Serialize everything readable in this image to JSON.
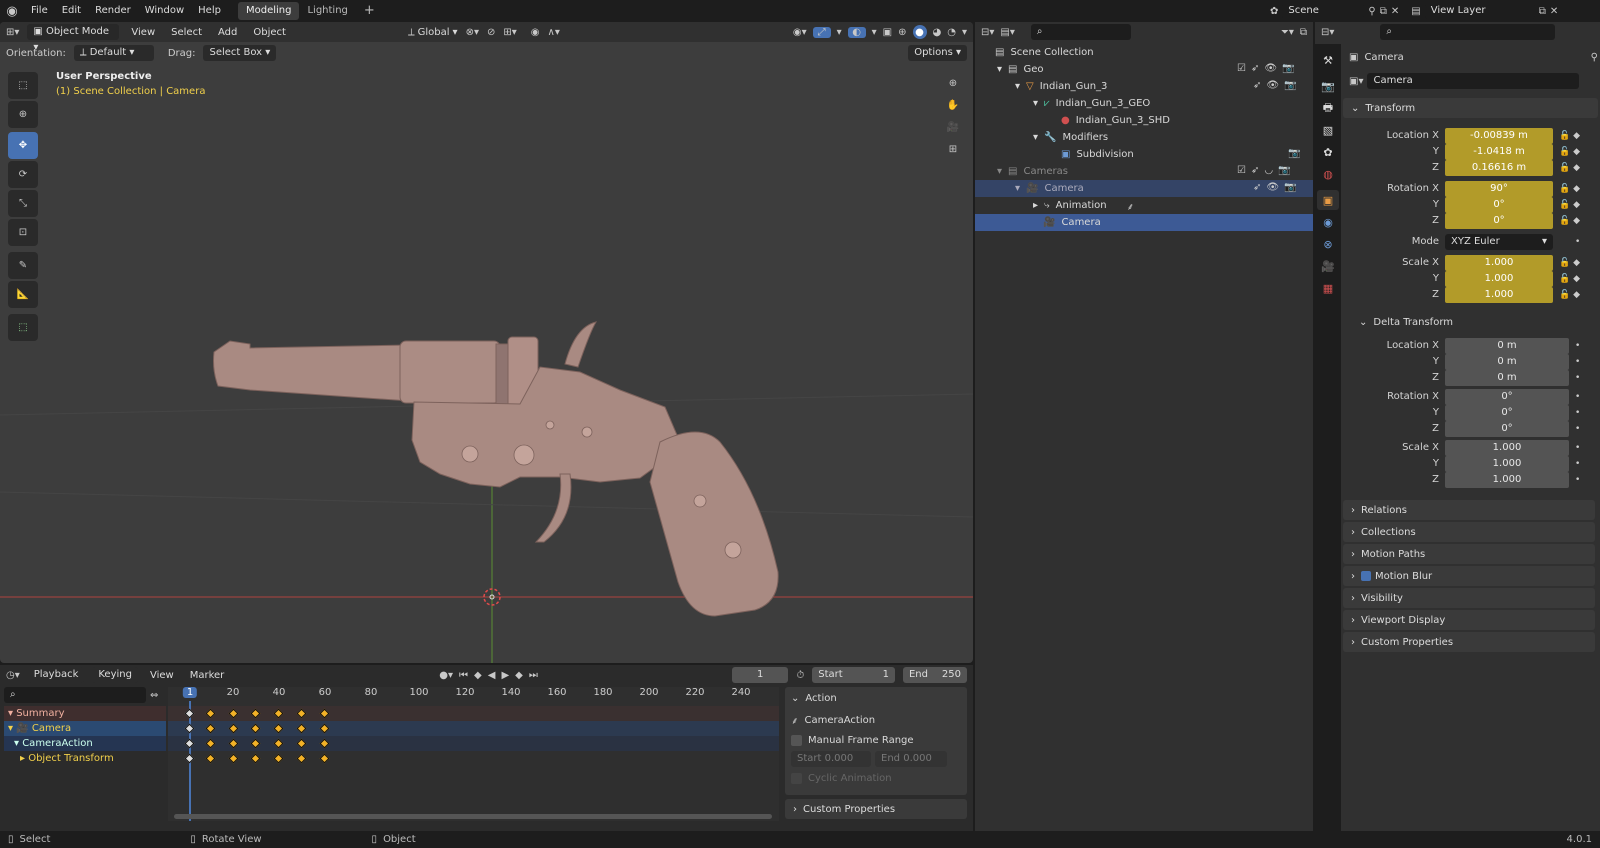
{
  "topbar": {
    "menus": [
      "File",
      "Edit",
      "Render",
      "Window",
      "Help"
    ],
    "workspaces": [
      "Modeling",
      "Lighting"
    ],
    "active_workspace": "Modeling",
    "add_tab": "+",
    "scene": "Scene",
    "view_layer": "View Layer"
  },
  "viewport": {
    "mode": "Object Mode",
    "menus": [
      "View",
      "Select",
      "Add",
      "Object"
    ],
    "transform_orientation": "Global",
    "orientation_label": "Orientation:",
    "orientation_value": "Default",
    "drag_label": "Drag:",
    "drag_value": "Select Box",
    "options": "Options",
    "overlay_title": "User Perspective",
    "overlay_sub": "(1) Scene Collection | Camera"
  },
  "timeline": {
    "menus": [
      "Playback",
      "Keying",
      "View",
      "Marker"
    ],
    "current_frame": "1",
    "start_label": "Start",
    "start": "1",
    "end_label": "End",
    "end": "250",
    "ruler": [
      "1",
      "20",
      "40",
      "60",
      "80",
      "100",
      "120",
      "140",
      "160",
      "180",
      "200",
      "220",
      "240"
    ],
    "channels": [
      "Summary",
      "Camera",
      "CameraAction",
      "Object Transform"
    ],
    "keyframes": [
      1,
      10,
      20,
      30,
      40,
      50,
      60
    ],
    "action_panel": {
      "title": "Action",
      "action_name": "CameraAction",
      "manual_frame_range": "Manual Frame Range",
      "start_label": "Start",
      "start": "0.000",
      "end_label": "End",
      "end": "0.000",
      "cyclic": "Cyclic Animation",
      "custom_props": "Custom Properties"
    }
  },
  "outliner": {
    "rows": [
      {
        "label": "Scene Collection"
      },
      {
        "label": "Geo"
      },
      {
        "label": "Indian_Gun_3"
      },
      {
        "label": "Indian_Gun_3_GEO"
      },
      {
        "label": "Indian_Gun_3_SHD"
      },
      {
        "label": "Modifiers"
      },
      {
        "label": "Subdivision"
      },
      {
        "label": "Cameras"
      },
      {
        "label": "Camera"
      },
      {
        "label": "Animation"
      },
      {
        "label": "Camera"
      }
    ]
  },
  "properties": {
    "object_name": "Camera",
    "object_field": "Camera",
    "transform_title": "Transform",
    "location": {
      "label": "Location X",
      "x": "-0.00839 m",
      "y": "-1.0418 m",
      "z": "0.16616 m"
    },
    "rotation": {
      "label": "Rotation X",
      "x": "90°",
      "y": "0°",
      "z": "0°"
    },
    "mode_label": "Mode",
    "mode_value": "XYZ Euler",
    "scale": {
      "label": "Scale X",
      "x": "1.000",
      "y": "1.000",
      "z": "1.000"
    },
    "axis_y": "Y",
    "axis_z": "Z",
    "delta_title": "Delta Transform",
    "delta_location": {
      "label": "Location X",
      "x": "0 m",
      "y": "0 m",
      "z": "0 m"
    },
    "delta_rotation": {
      "label": "Rotation X",
      "x": "0°",
      "y": "0°",
      "z": "0°"
    },
    "delta_scale": {
      "label": "Scale X",
      "x": "1.000",
      "y": "1.000",
      "z": "1.000"
    },
    "panels": [
      "Relations",
      "Collections",
      "Motion Paths",
      "Motion Blur",
      "Visibility",
      "Viewport Display",
      "Custom Properties"
    ]
  },
  "status": {
    "select": "Select",
    "rotate": "Rotate View",
    "object": "Object",
    "version": "4.0.1"
  },
  "colors": {
    "accent": "#4772b3",
    "keyframe": "#f3b227",
    "field_yellow": "#b29b29",
    "model": "#a98a82"
  }
}
